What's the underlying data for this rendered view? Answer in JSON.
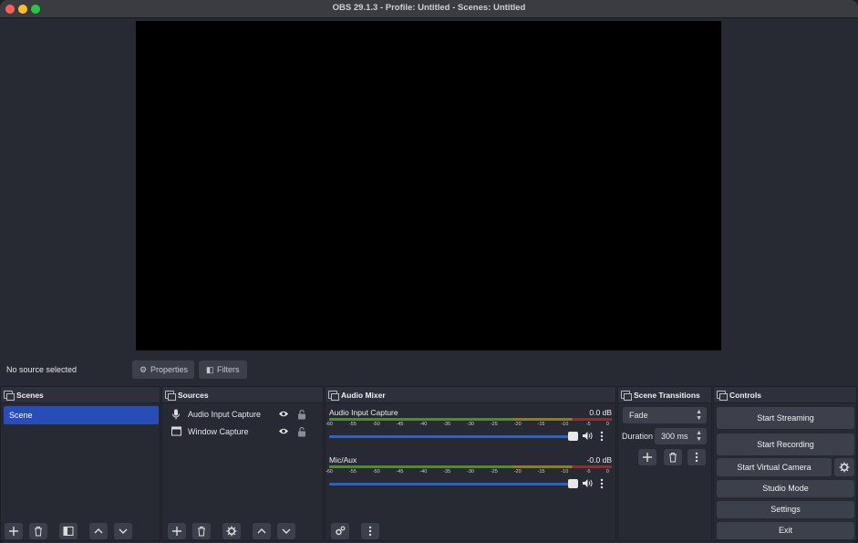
{
  "window": {
    "title": "OBS 29.1.3 - Profile: Untitled - Scenes: Untitled"
  },
  "context": {
    "status": "No source selected",
    "properties_label": "Properties",
    "filters_label": "Filters"
  },
  "scenes": {
    "title": "Scenes",
    "items": [
      "Scene"
    ]
  },
  "sources": {
    "title": "Sources",
    "items": [
      {
        "label": "Audio Input Capture",
        "icon": "microphone-icon"
      },
      {
        "label": "Window Capture",
        "icon": "window-icon"
      }
    ]
  },
  "mixer": {
    "title": "Audio Mixer",
    "scale": [
      "-60",
      "-55",
      "-50",
      "-45",
      "-40",
      "-35",
      "-30",
      "-25",
      "-20",
      "-15",
      "-10",
      "-5",
      "0"
    ],
    "channels": [
      {
        "name": "Audio Input Capture",
        "db": "0.0 dB",
        "volume": 1.0
      },
      {
        "name": "Mic/Aux",
        "db": "-0.0 dB",
        "volume": 1.0
      }
    ]
  },
  "transitions": {
    "title": "Scene Transitions",
    "selected": "Fade",
    "duration_label": "Duration",
    "duration_value": "300 ms"
  },
  "controls": {
    "title": "Controls",
    "start_streaming": "Start Streaming",
    "start_recording": "Start Recording",
    "start_virtual_camera": "Start Virtual Camera",
    "studio_mode": "Studio Mode",
    "settings": "Settings",
    "exit": "Exit"
  },
  "colors": {
    "accent": "#284cb8",
    "panel": "#272a33",
    "button": "#3c404b",
    "volume_bar": "#2a63c8"
  }
}
